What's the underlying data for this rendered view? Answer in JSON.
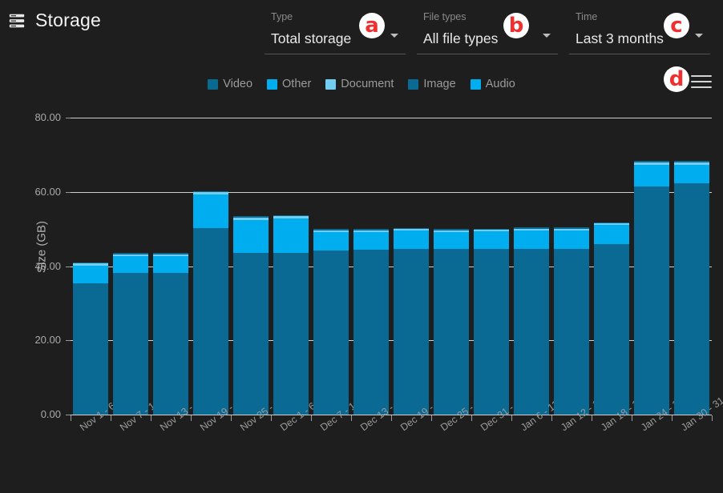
{
  "header": {
    "title": "Storage",
    "icon": "storage-stack-icon"
  },
  "selectors": [
    {
      "label": "Type",
      "value": "Total storage",
      "caret": "chevron-down-icon",
      "badge": "a"
    },
    {
      "label": "File types",
      "value": "All file types",
      "caret": "chevron-down-icon",
      "badge": "b"
    },
    {
      "label": "Time",
      "value": "Last 3 months",
      "caret": "chevron-down-icon",
      "badge": "c"
    }
  ],
  "menu": {
    "icon": "hamburger-menu-icon",
    "badge": "d"
  },
  "chart_data": {
    "type": "bar",
    "stacked": true,
    "title": "",
    "xlabel": "",
    "ylabel": "Size (GB)",
    "ylim": [
      0,
      80
    ],
    "yticks": [
      0.0,
      20.0,
      40.0,
      60.0,
      80.0
    ],
    "ytick_labels": [
      "0.00",
      "20.00",
      "40.00",
      "60.00",
      "80.00"
    ],
    "grid": true,
    "legend_position": "top-center",
    "colors": {
      "Video": "#09698e",
      "Other": "#00aeef",
      "Document": "#72cdf0",
      "Image": "#0a6a94",
      "Audio": "#00aeef"
    },
    "categories": [
      "Nov 1 - 6",
      "Nov 7 - 12",
      "Nov 13 - 18",
      "Nov 19 - 24",
      "Nov 25 - 30",
      "Dec 1 - 6",
      "Dec 7 - 12",
      "Dec 13 - 18",
      "Dec 19 - 24",
      "Dec 25 - 30",
      "Dec 31 - Jan 5",
      "Jan 6 - 11",
      "Jan 12 - 17",
      "Jan 18 - 23",
      "Jan 24 - 29",
      "Jan 30 - 31"
    ],
    "series": [
      {
        "name": "Image",
        "values": [
          35.3,
          38.2,
          38.2,
          50.3,
          43.5,
          43.5,
          44.2,
          44.5,
          44.6,
          44.6,
          44.6,
          44.6,
          44.6,
          46.0,
          61.5,
          62.3
        ]
      },
      {
        "name": "Other",
        "values": [
          4.8,
          4.5,
          4.5,
          9.0,
          9.0,
          9.3,
          5.0,
          4.7,
          4.9,
          4.6,
          4.7,
          5.0,
          5.0,
          5.0,
          5.8,
          5.0
        ]
      },
      {
        "name": "Document",
        "values": [
          0.6,
          0.5,
          0.5,
          0.6,
          0.6,
          0.6,
          0.5,
          0.5,
          0.5,
          0.5,
          0.5,
          0.5,
          0.5,
          0.5,
          0.7,
          0.7
        ]
      },
      {
        "name": "Video",
        "values": [
          0.3,
          0.3,
          0.3,
          0.3,
          0.3,
          0.3,
          0.3,
          0.3,
          0.3,
          0.3,
          0.3,
          0.3,
          0.3,
          0.3,
          0.3,
          0.3
        ]
      },
      {
        "name": "Audio",
        "values": [
          0.0,
          0.0,
          0.0,
          0.0,
          0.0,
          0.0,
          0.0,
          0.0,
          0.0,
          0.0,
          0.0,
          0.0,
          0.0,
          0.0,
          0.0,
          0.0
        ]
      }
    ],
    "totals": [
      41.0,
      43.5,
      43.5,
      60.2,
      53.1,
      53.7,
      50.0,
      50.0,
      50.3,
      50.0,
      50.1,
      50.4,
      50.4,
      51.8,
      68.3,
      68.3
    ],
    "legend": [
      {
        "name": "Video",
        "color": "#09698e"
      },
      {
        "name": "Other",
        "color": "#00aeef"
      },
      {
        "name": "Document",
        "color": "#72cdf0"
      },
      {
        "name": "Image",
        "color": "#0a6a94"
      },
      {
        "name": "Audio",
        "color": "#00aeef"
      }
    ]
  }
}
